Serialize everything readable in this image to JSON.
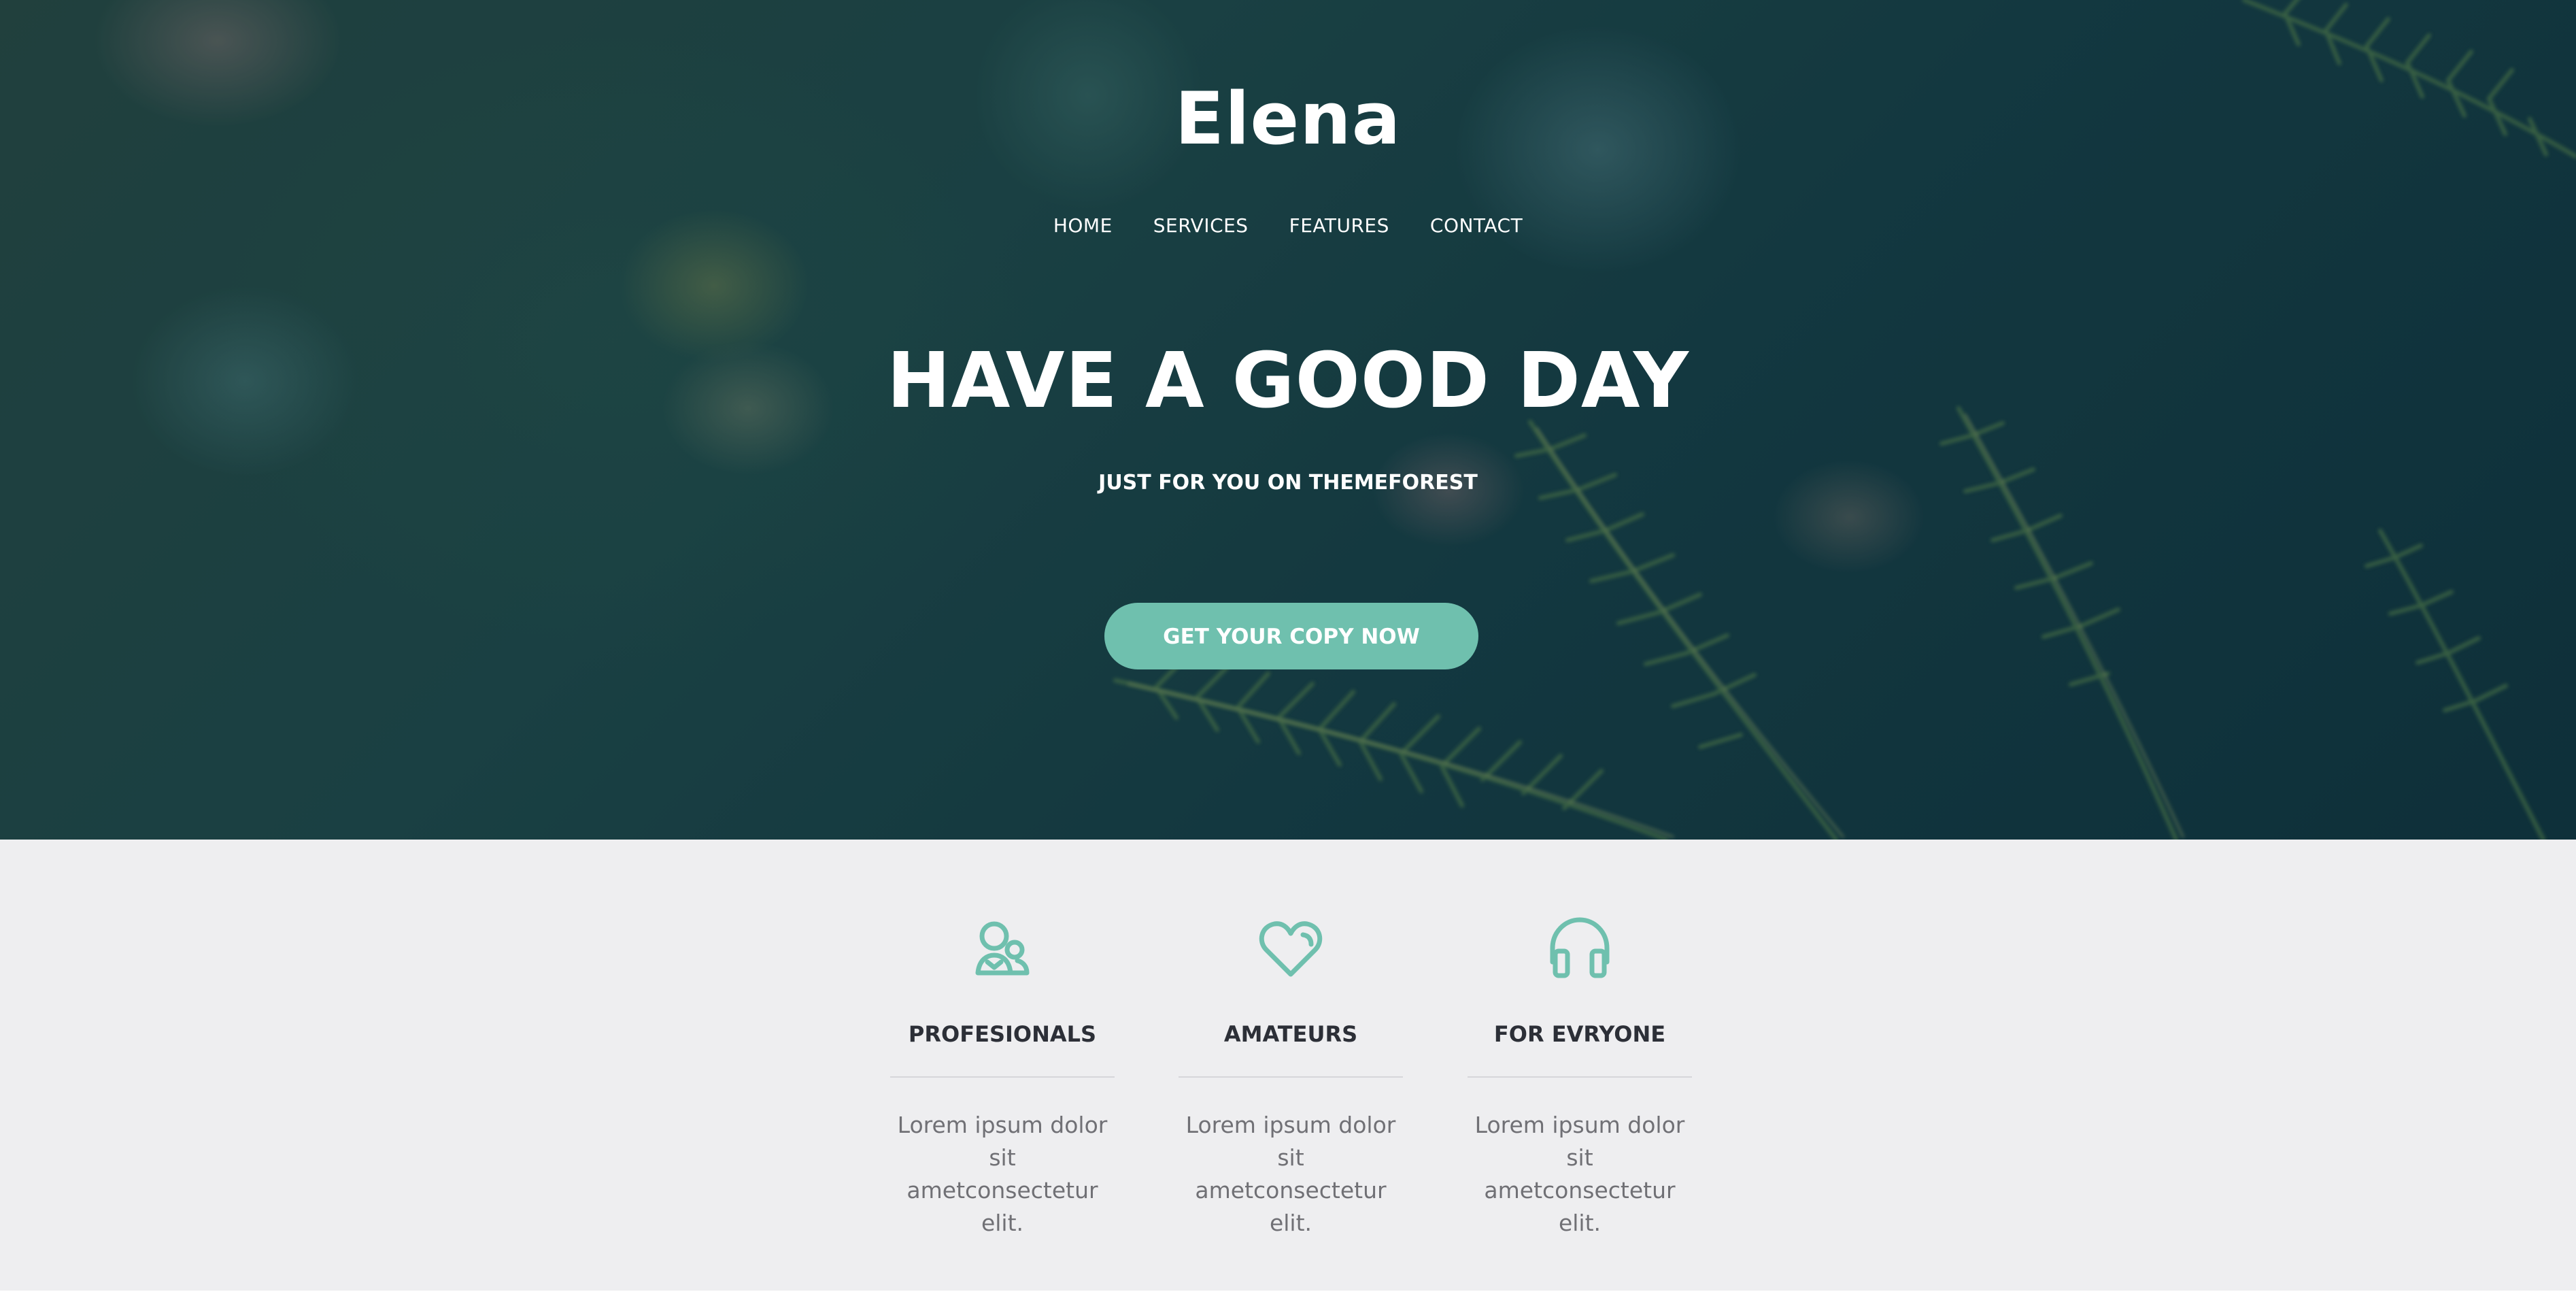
{
  "brand": {
    "name": "Elena"
  },
  "nav": {
    "items": [
      {
        "label": "HOME"
      },
      {
        "label": "SERVICES"
      },
      {
        "label": "FEATURES"
      },
      {
        "label": "CONTACT"
      }
    ]
  },
  "hero": {
    "title": "HAVE A GOOD DAY",
    "subtitle": "JUST FOR YOU ON THEMEFOREST",
    "cta_label": "GET YOUR COPY NOW"
  },
  "features": {
    "items": [
      {
        "icon": "user-group-icon",
        "title": "PROFESIONALS",
        "text": "Lorem ipsum dolor sit ametconsectetur elit."
      },
      {
        "icon": "heart-icon",
        "title": "AMATEURS",
        "text": "Lorem ipsum dolor sit ametconsectetur elit."
      },
      {
        "icon": "headphones-icon",
        "title": "FOR EVRYONE",
        "text": "Lorem ipsum dolor sit ametconsectetur elit."
      }
    ]
  },
  "colors": {
    "accent": "#6fc0ae",
    "hero_dark": "#163f48",
    "features_bg": "#eeeef0",
    "heading_text": "#2c2f37",
    "body_text": "#707075"
  }
}
